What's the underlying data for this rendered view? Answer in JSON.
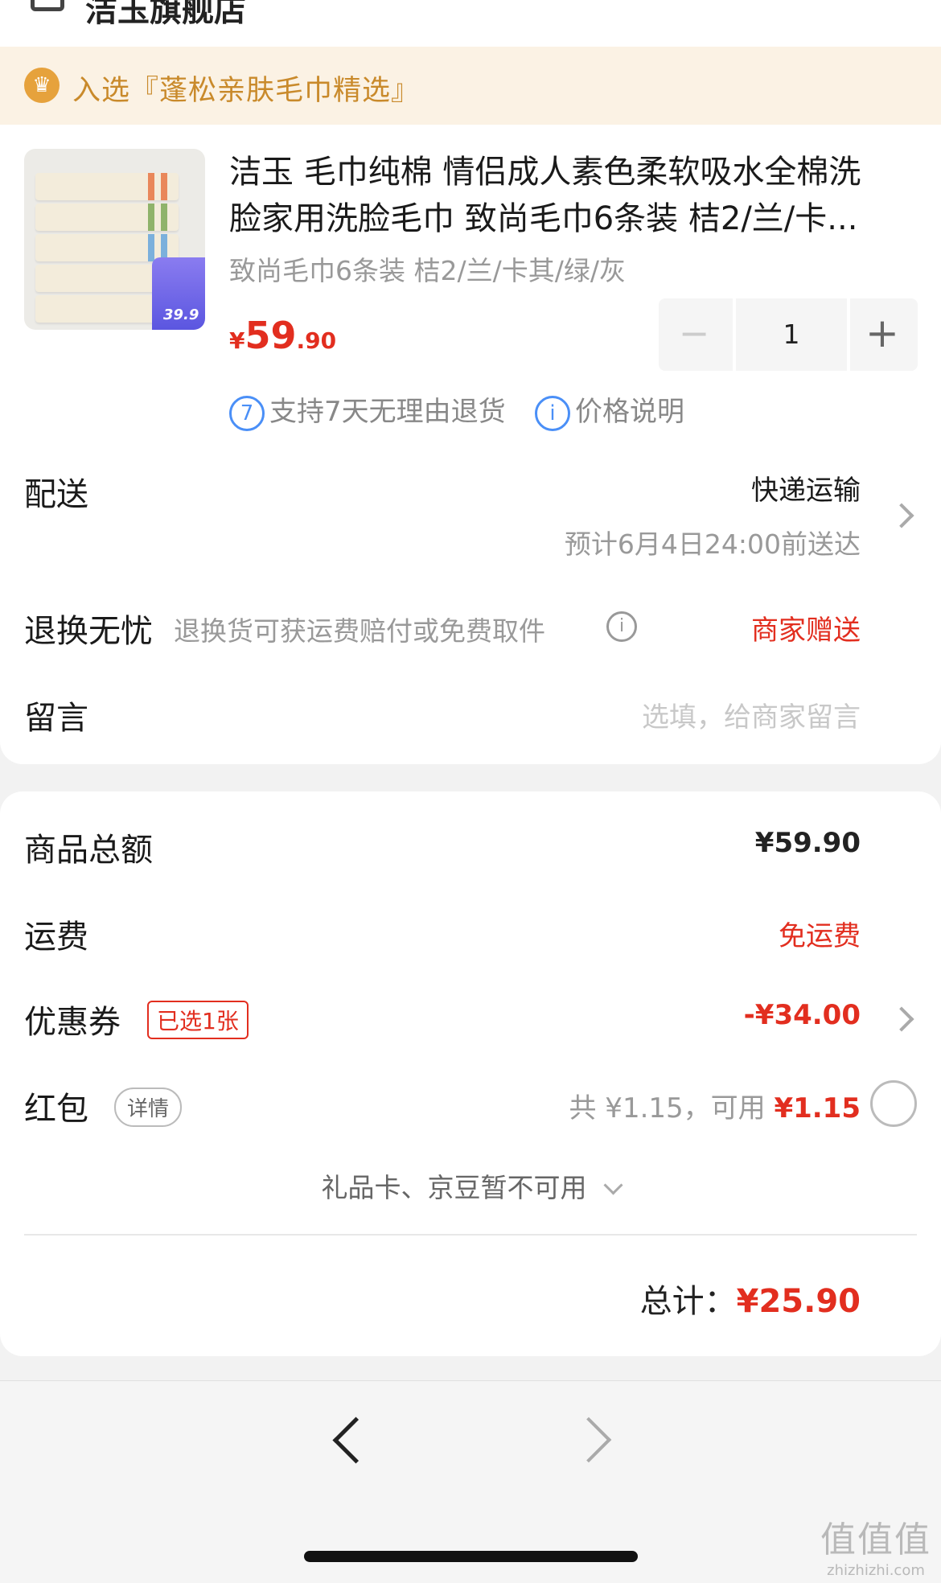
{
  "store": {
    "name": "洁玉旗舰店"
  },
  "banner": {
    "text": "入选『蓬松亲肤毛巾精选』"
  },
  "product": {
    "title_line1": "洁玉 毛巾纯棉 情侣成人素色柔软吸水全棉洗",
    "title_line2": "脸家用洗脸毛巾 致尚毛巾6条装 桔2/兰/卡...",
    "spec": "致尚毛巾6条装 桔2/兰/卡其/绿/灰",
    "image_tag_price": "39.9",
    "price_currency": "¥",
    "price_int": "59",
    "price_dec": ".90",
    "quantity": "1",
    "minus": "−",
    "plus": "+"
  },
  "services": {
    "return_icon": "7",
    "return_text": "支持7天无理由退货",
    "price_icon": "i",
    "price_text": "价格说明"
  },
  "delivery": {
    "label": "配送",
    "method": "快递运输",
    "eta": "预计6月4日24:00前送达"
  },
  "returns": {
    "label": "退换无忧",
    "desc": "退换货可获运费赔付或免费取件",
    "value": "商家赠送"
  },
  "message": {
    "label": "留言",
    "placeholder": "选填，给商家留言"
  },
  "summary": {
    "goods_label": "商品总额",
    "goods_value": "¥59.90",
    "shipping_label": "运费",
    "shipping_value": "免运费",
    "coupon_label": "优惠券",
    "coupon_badge": "已选1张",
    "coupon_value": "-¥34.00",
    "redpack_label": "红包",
    "redpack_badge": "详情",
    "redpack_total": "共 ¥1.15，可用 ",
    "redpack_available": "¥1.15",
    "gift_text": "礼品卡、京豆暂不可用",
    "total_label": "总计：",
    "total_value": "¥25.90"
  },
  "watermark": {
    "title": "值值值",
    "url": "zhizhizhi.com"
  },
  "colors": {
    "accent_red": "#e22e1f",
    "banner_gold": "#c98a2b",
    "info_blue": "#4a8ff7"
  }
}
